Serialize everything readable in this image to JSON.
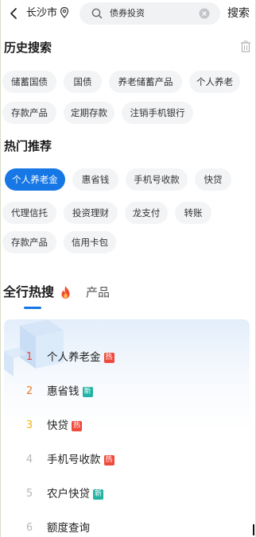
{
  "header": {
    "city": "长沙市",
    "search_value": "债券投资",
    "search_button": "搜索"
  },
  "history": {
    "title": "历史搜索",
    "items": [
      "储蓄国债",
      "国债",
      "养老储蓄产品",
      "个人养老",
      "存款产品",
      "定期存款",
      "注销手机银行"
    ]
  },
  "hot": {
    "title": "热门推荐",
    "items": [
      "个人养老金",
      "惠省钱",
      "手机号收款",
      "快贷",
      "代理信托",
      "投资理财",
      "龙支付",
      "转账",
      "存款产品",
      "信用卡包"
    ]
  },
  "tabs": {
    "active": "全行热搜",
    "other": "产品"
  },
  "ranking": [
    {
      "rank": "1",
      "name": "个人养老金",
      "badge": "热",
      "rank_color": "#e8463a",
      "badge_color": "#ef4b3c"
    },
    {
      "rank": "2",
      "name": "惠省钱",
      "badge": "新",
      "rank_color": "#f07a2a",
      "badge_color": "#22b3a4"
    },
    {
      "rank": "3",
      "name": "快贷",
      "badge": "热",
      "rank_color": "#f2b416",
      "badge_color": "#ef4b3c"
    },
    {
      "rank": "4",
      "name": "手机号收款",
      "badge": "热",
      "rank_color": "#b7b7b7",
      "badge_color": "#ef4b3c"
    },
    {
      "rank": "5",
      "name": "农户快贷",
      "badge": "新",
      "rank_color": "#b7b7b7",
      "badge_color": "#22b3a4"
    },
    {
      "rank": "6",
      "name": "额度查询",
      "badge": "",
      "rank_color": "#b7b7b7",
      "badge_color": ""
    }
  ]
}
